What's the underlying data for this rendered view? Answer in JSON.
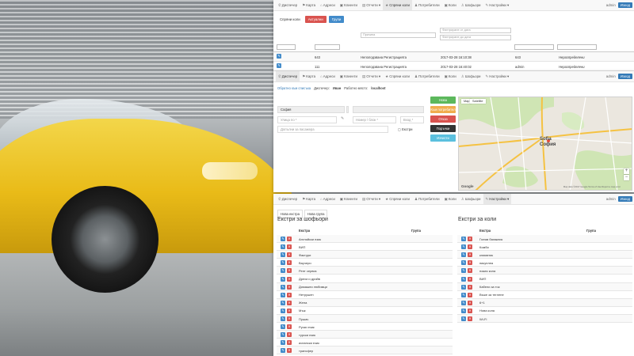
{
  "colors": {
    "primary": "#428bca",
    "danger": "#d9534f",
    "success": "#5cb85c",
    "warning": "#f0ad4e",
    "dark": "#333333",
    "info": "#5bc0de"
  },
  "nav_full": [
    {
      "icon": "phone-icon",
      "glyph": "✆",
      "label": "Диспечер"
    },
    {
      "icon": "map-marker-icon",
      "glyph": "⚑",
      "label": "Карта"
    },
    {
      "icon": "address-icon",
      "glyph": "⌂",
      "label": "Адреси"
    },
    {
      "icon": "car-icon",
      "glyph": "▣",
      "label": "Клиенти"
    },
    {
      "icon": "reports-icon",
      "glyph": "▤",
      "label": "Отчети ▾"
    },
    {
      "icon": "star-icon",
      "glyph": "★",
      "label": "Спряни коли"
    },
    {
      "icon": "users-icon",
      "glyph": "♟",
      "label": "Потребители"
    },
    {
      "icon": "car-icon",
      "glyph": "▣",
      "label": "Коли"
    },
    {
      "icon": "drivers-icon",
      "glyph": "♙",
      "label": "Шофьори"
    },
    {
      "icon": "wrench-icon",
      "glyph": "✎",
      "label": "Настройки ▾"
    }
  ],
  "nav_user": "admin",
  "nav_exit": "Изход",
  "screen1": {
    "tab_plain": "Спряни коли",
    "btn_actual": "Актуални",
    "btn_groups": "Групи",
    "filter_from": "Филтриране от дата",
    "filter_to": "Филтриране до дата",
    "filter_reason": "Причина",
    "headers": [
      "Всички",
      "Потребител",
      "Оператор",
      "Време"
    ],
    "rows": [
      {
        "user": "643",
        "reason": "Неполодзвана Регистрацията",
        "date": "2017-03-28 16:10:38",
        "operator": "643",
        "time": "Неразпределени"
      },
      {
        "user": "111",
        "reason": "Неполодзвана Регистрацията",
        "date": "2017-03-28 16:40:02",
        "operator": "admin",
        "time": "Неразпределени"
      }
    ]
  },
  "screen2": {
    "crumb_link": "Обратно към списъка",
    "crumb_dispatcher_label": "Диспечер:",
    "crumb_dispatcher": "Иван",
    "crumb_place_label": "Работно място:",
    "crumb_place": "localhost",
    "city": "София",
    "street_ph": "Улица по *",
    "number_ph": "Номер / блок *",
    "entrance_ph": "Вход *",
    "extra_ph": "Допълни за пасажера",
    "extras_label": "Екстри",
    "btn_new": "Нова",
    "btn_next": "Към потребител",
    "btn_wait": "Отказ",
    "btn_orders": "Поръчки",
    "btn_clear": "Изчисти",
    "map_tab_map": "Map",
    "map_tab_sat": "Satellite",
    "map_city": "Sofia",
    "map_city_bg": "София",
    "map_google": "Google",
    "map_footer": "Map data ©2017 Google   Terms of Use   Report a map error",
    "zoom_in": "+",
    "zoom_out": "−"
  },
  "screen3": {
    "tab_new_extra": "Нова екстра",
    "tab_new_group": "Нова група",
    "drivers_title": "Екстри за шофьори",
    "cars_title": "Екстри за коли",
    "col_extra": "Екстра",
    "col_group": "Група",
    "driver_extras": [
      "Английски език",
      "ВИП",
      "Фактури",
      "Ваучери",
      "Рент сервиз",
      "Дрехи и дрийв",
      "Домашни любимци",
      "Нетрушен",
      "Жена",
      "Мъж",
      "Пушач",
      "Руски език",
      "турски език",
      "испански език",
      "трансфер"
    ],
    "car_extras": [
      "Голям багажник",
      "Комби",
      "климатик",
      "пикуплеа",
      "нокия кола",
      "ВИП",
      "Кабели за ток",
      "Въже за теглене",
      "6+1",
      "Нова кола",
      "Wi-Fi"
    ]
  }
}
